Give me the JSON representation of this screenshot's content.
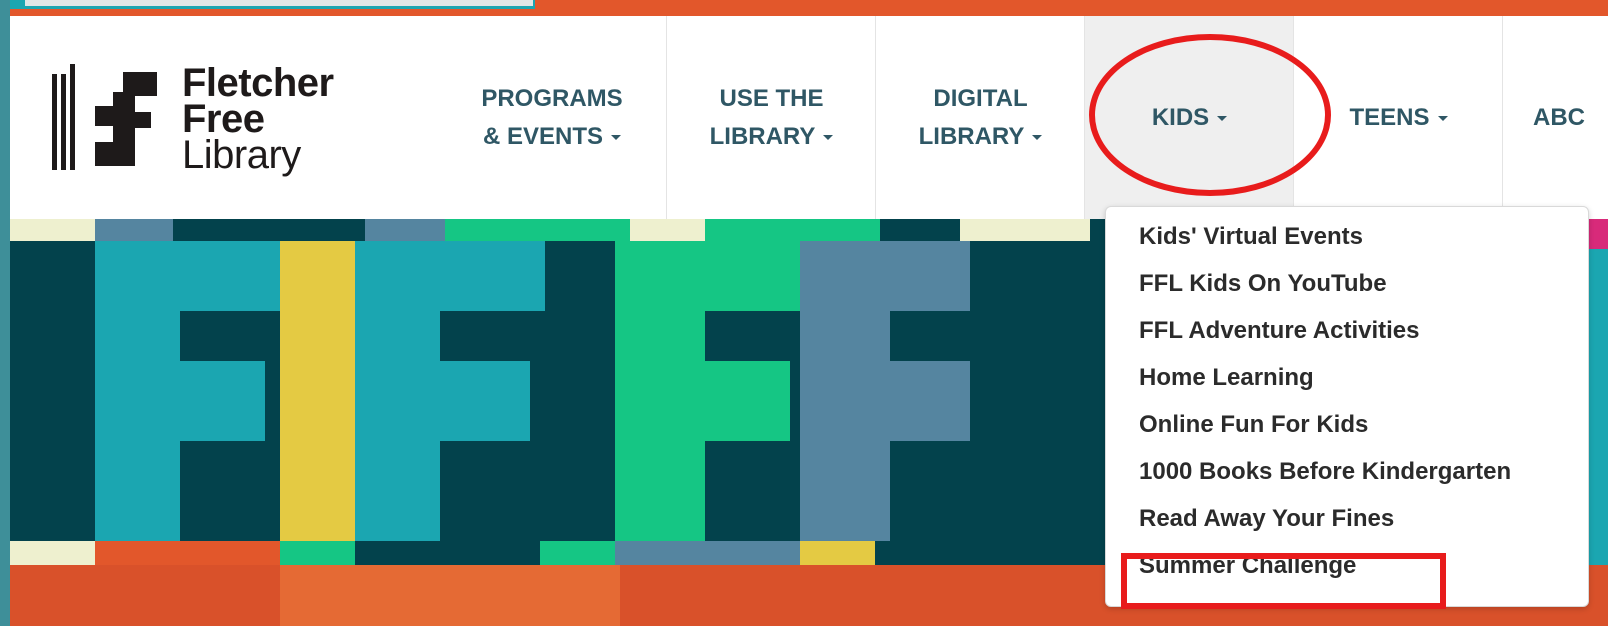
{
  "logo": {
    "line1": "Fletcher",
    "line2": "Free",
    "line3": "Library"
  },
  "nav": {
    "items": [
      {
        "line1": "PROGRAMS",
        "line2": "& EVENTS"
      },
      {
        "line1": "USE THE",
        "line2": "LIBRARY"
      },
      {
        "line1": "DIGITAL",
        "line2": "LIBRARY"
      },
      {
        "line1": "KIDS",
        "line2": ""
      },
      {
        "line1": "TEENS",
        "line2": ""
      },
      {
        "line1": "ABC",
        "line2": ""
      }
    ]
  },
  "kids_menu": {
    "items": [
      "Kids' Virtual Events",
      "FFL Kids On YouTube",
      "FFL Adventure Activities",
      "Home Learning",
      "Online Fun For Kids",
      "1000 Books Before Kindergarten",
      "Read Away Your Fines",
      "Summer Challenge"
    ]
  },
  "colors": {
    "accent_red": "#e81c1c",
    "nav_text": "#2f5765",
    "dark_teal": "#03424c",
    "teal": "#1ba6b1",
    "yellow": "#e4ca43",
    "green": "#15c684",
    "slate_blue": "#5585a0",
    "orange": "#e2572b"
  }
}
